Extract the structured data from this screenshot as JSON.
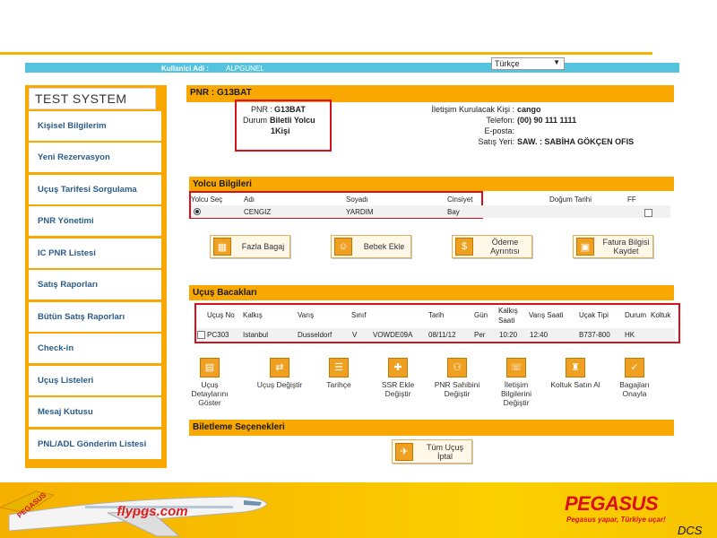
{
  "header": {
    "user_label": "Kullanici Adi :",
    "user_value": "ALPGUNEL",
    "language": "Türkçe"
  },
  "sidebar": {
    "title": "TEST SYSTEM",
    "items": [
      {
        "label": "Kişisel Bilgilerim"
      },
      {
        "label": "Yeni Rezervasyon"
      },
      {
        "label": "Uçuş Tarifesi Sorgulama"
      },
      {
        "label": "PNR Yönetimi"
      },
      {
        "label": "IC PNR Listesi"
      },
      {
        "label": "Satış Raporları"
      },
      {
        "label": "Bütün Satış Raporları"
      },
      {
        "label": "Check-in"
      },
      {
        "label": "Uçuş Listeleri"
      },
      {
        "label": "Mesaj Kutusu"
      },
      {
        "label": "PNL/ADL Gönderim Listesi"
      }
    ]
  },
  "pnr_section": {
    "header": "PNR : G13BAT",
    "pnr_label": "PNR :",
    "pnr_value": "G13BAT",
    "status_label": "Durum",
    "status_value": "Biletli Yolcu",
    "pax_count": "1Kişi",
    "contact_label": "İletişim Kurulacak Kişi :",
    "contact_value": "cango",
    "phone_label": "Telefon:",
    "phone_value": "(00) 90 111 1111",
    "email_label": "E-posta:",
    "email_value": "",
    "sales_label": "Satış Yeri:",
    "sales_value": "SAW. : SABİHA GÖKÇEN OFIS"
  },
  "passenger_section": {
    "header": "Yolcu Bilgileri",
    "columns": [
      "Yolcu Seç",
      "Adı",
      "Soyadı",
      "Cinsiyet",
      "Doğum Tarihi",
      "FF"
    ],
    "rows": [
      {
        "name": "CENGIZ",
        "surname": "YARDIM",
        "gender": "Bay",
        "birth": ""
      }
    ],
    "buttons": {
      "extra_baggage": "Fazla Bagaj",
      "add_infant": "Bebek Ekle",
      "payment_details_1": "Ödeme",
      "payment_details_2": "Ayrıntısı",
      "save_invoice_1": "Fatura Bilgisi",
      "save_invoice_2": "Kaydet"
    }
  },
  "flight_section": {
    "header": "Uçuş Bacakları",
    "columns": [
      "Uçuş No",
      "Kalkış",
      "Varış",
      "Sınıf",
      "Tarih",
      "Gün",
      "Kalkış Saati",
      "Varış Saati",
      "Uçak Tipi",
      "Durum",
      "Koltuk"
    ],
    "rows": [
      {
        "flight_no": "PC303",
        "departure": "Istanbul",
        "arrival": "Dusseldorf",
        "class": "V",
        "fare": "VOWDE09A",
        "date": "08/11/12",
        "day": "Per",
        "dep_time": "10:20",
        "arr_time": "12:40",
        "aircraft": "B737-800",
        "status": "HK"
      }
    ],
    "tools": [
      {
        "label": "Uçuş Detaylarını Göster",
        "icon": "flight-details-icon"
      },
      {
        "label": "Uçuş Değiştir",
        "icon": "change-flight-icon"
      },
      {
        "label": "Tarihçe",
        "icon": "history-icon"
      },
      {
        "label": "SSR Ekle Değiştir",
        "icon": "ssr-icon"
      },
      {
        "label": "PNR Sahibini Değiştir",
        "icon": "pnr-owner-icon"
      },
      {
        "label": "İletişim Bilgilerini Değiştir",
        "icon": "contact-info-icon"
      },
      {
        "label": "Koltuk Satın Al",
        "icon": "seat-icon"
      },
      {
        "label": "Bagajları Onayla",
        "icon": "baggage-icon"
      }
    ]
  },
  "ticketing_section": {
    "header": "Biletleme Seçenekleri",
    "cancel_all_1": "Tüm Uçuş",
    "cancel_all_2": "İptal"
  },
  "banner": {
    "brand": "PEGASUS",
    "slogan": "Pegasus yapar, Türkiye uçar!",
    "plane_text": "flypgs.com",
    "tail_text": "PEGASUS",
    "corner": "DCS"
  }
}
